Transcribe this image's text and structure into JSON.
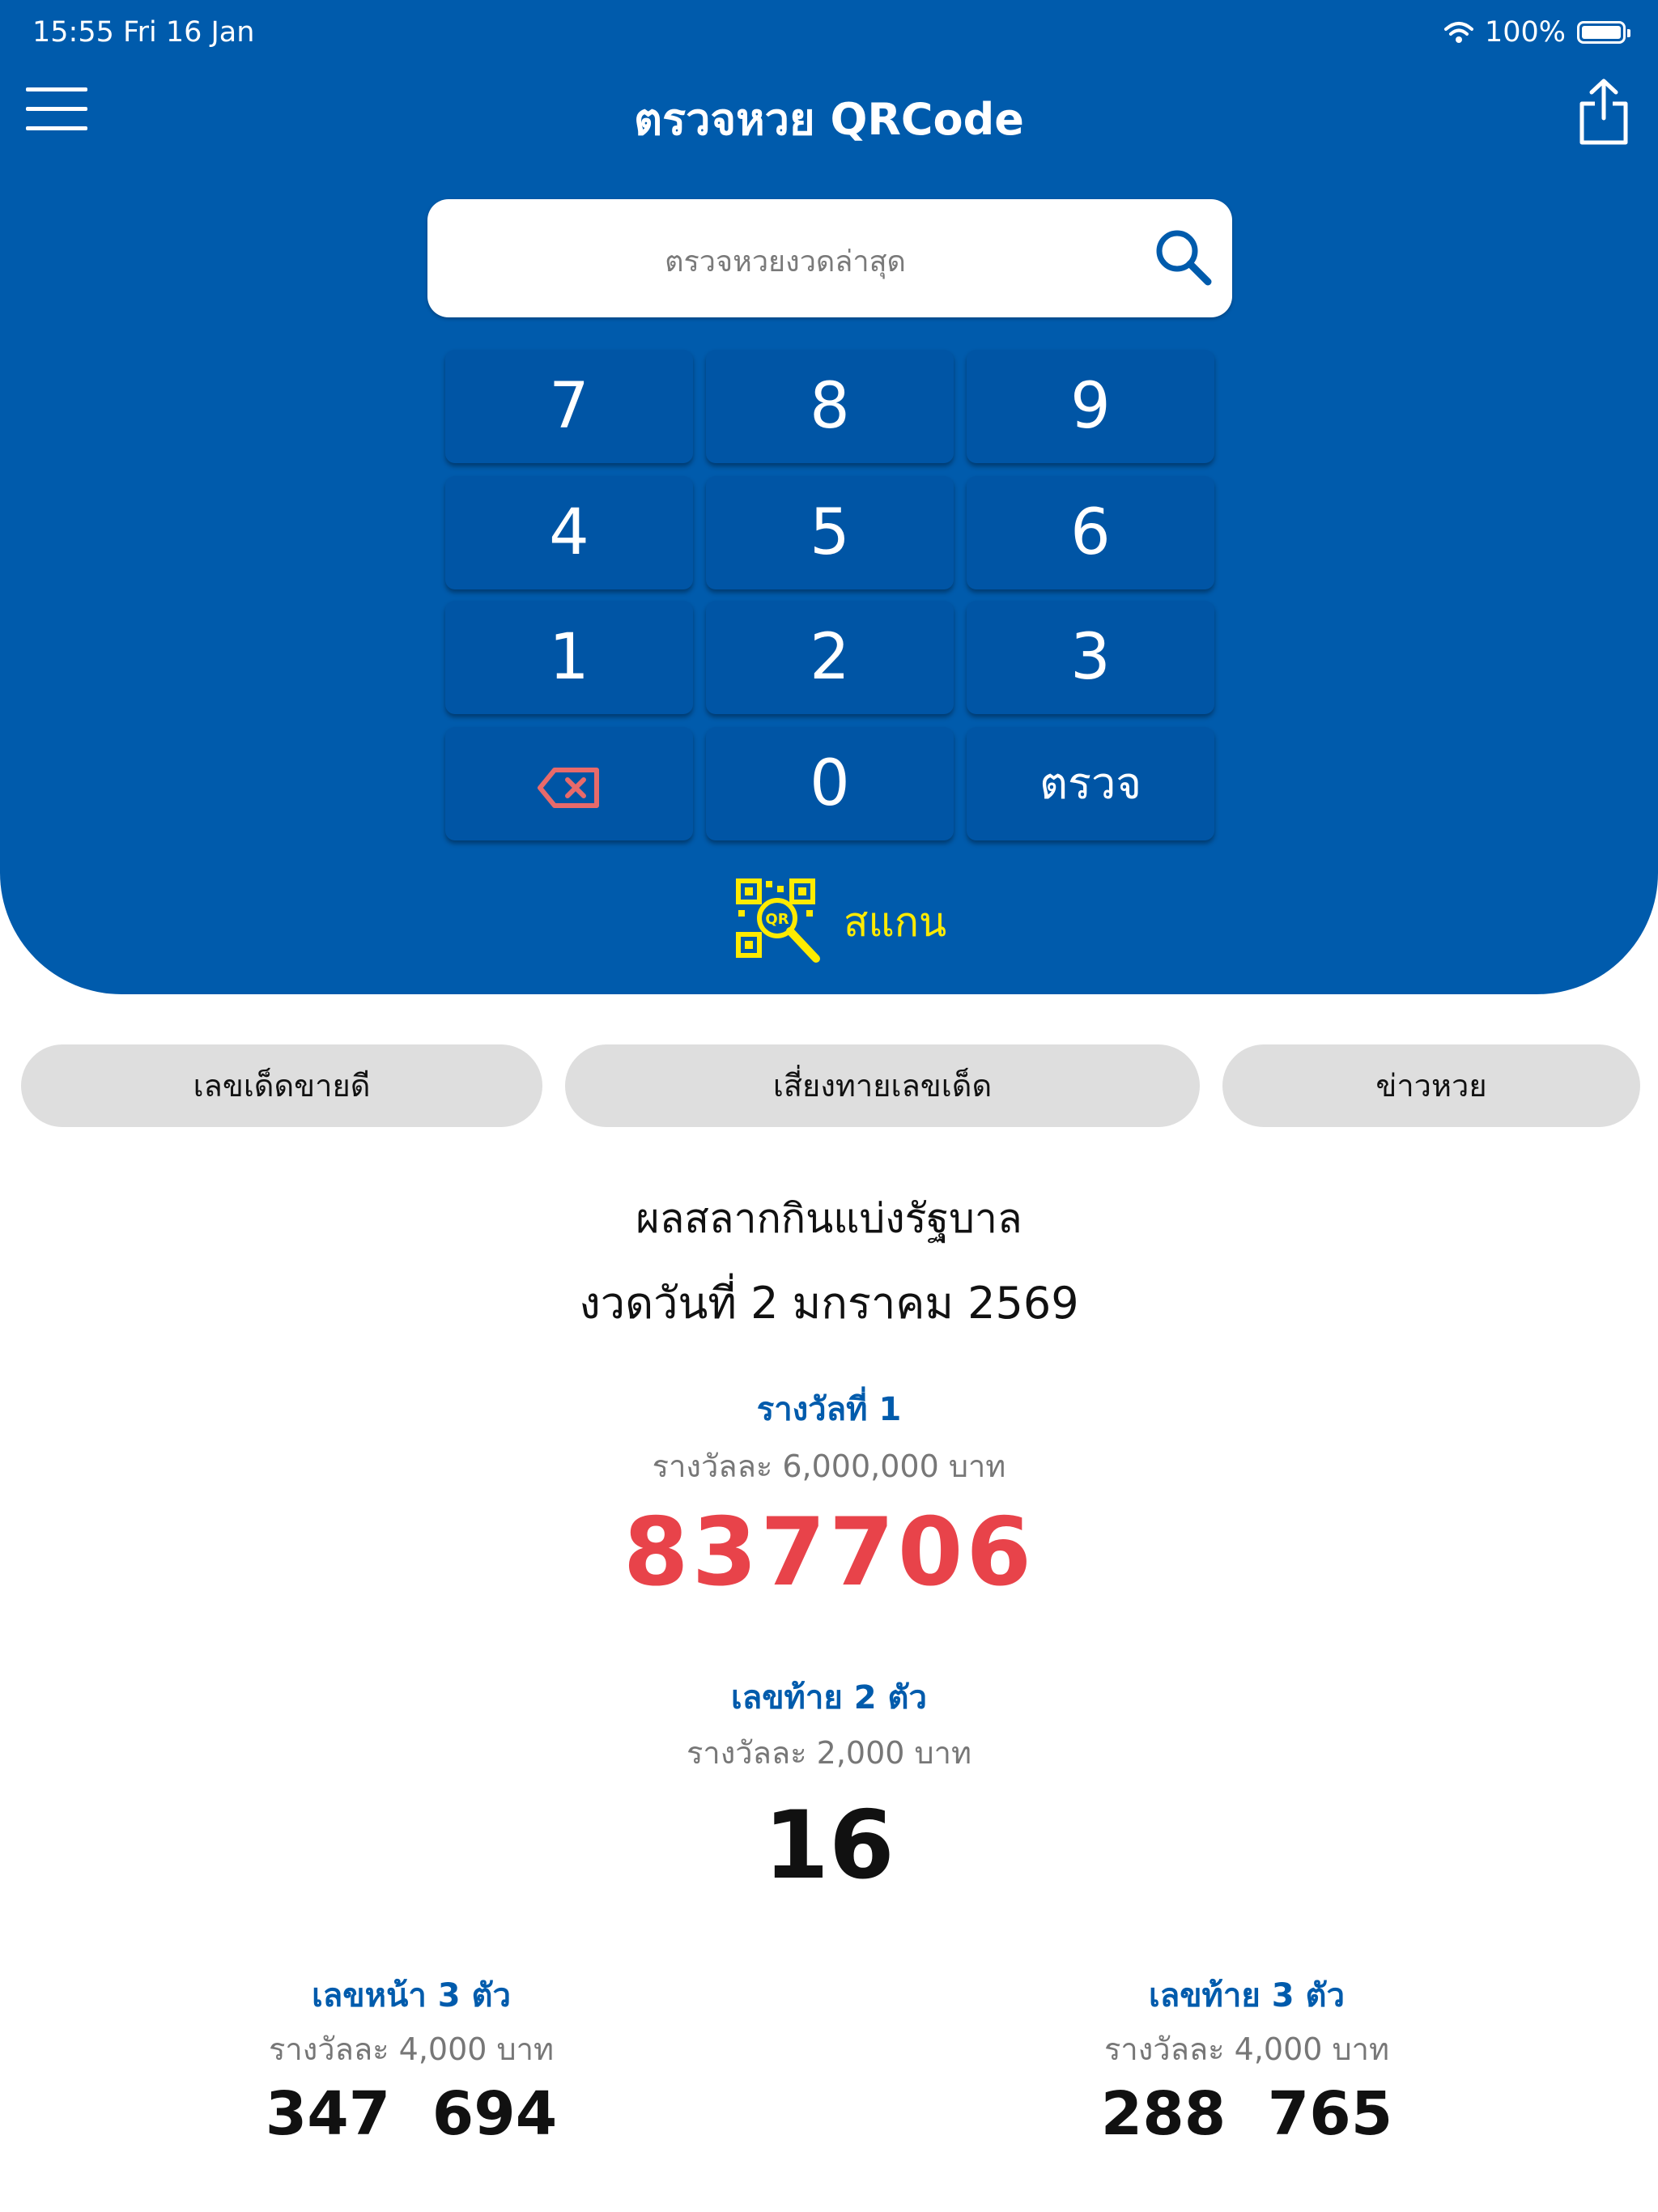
{
  "status_bar": {
    "time_date": "15:55  Fri 16 Jan",
    "battery": "100%"
  },
  "header": {
    "title": "ตรวจหวย QRCode"
  },
  "search": {
    "placeholder": "ตรวจหวยงวดล่าสุด"
  },
  "keypad": {
    "keys": [
      "7",
      "8",
      "9",
      "4",
      "5",
      "6",
      "1",
      "2",
      "3"
    ],
    "zero": "0",
    "check": "ตรวจ"
  },
  "scan": {
    "label": "สแกน",
    "qr_text": "QR"
  },
  "tabs": [
    "เลขเด็ดขายดี",
    "เสี่ยงทายเลขเด็ด",
    "ข่าวหวย"
  ],
  "results": {
    "heading": "ผลสลากกินแบ่งรัฐบาล",
    "draw_date": "งวดวันที่ 2 มกราคม 2569",
    "first": {
      "title": "รางวัลที่ 1",
      "prize": "รางวัลละ 6,000,000 บาท",
      "number": "837706"
    },
    "last2": {
      "title": "เลขท้าย 2 ตัว",
      "prize": "รางวัลละ 2,000 บาท",
      "number": "16"
    },
    "front3": {
      "title": "เลขหน้า 3 ตัว",
      "prize": "รางวัลละ 4,000 บาท",
      "numbers": [
        "347",
        "694"
      ]
    },
    "last3": {
      "title": "เลขท้าย 3 ตัว",
      "prize": "รางวัลละ 4,000 บาท",
      "numbers": [
        "288",
        "765"
      ]
    }
  },
  "colors": {
    "primary": "#005BAC",
    "key": "#0055A5",
    "accent_red": "#E8434A",
    "scan_yellow": "#FFEB00"
  }
}
